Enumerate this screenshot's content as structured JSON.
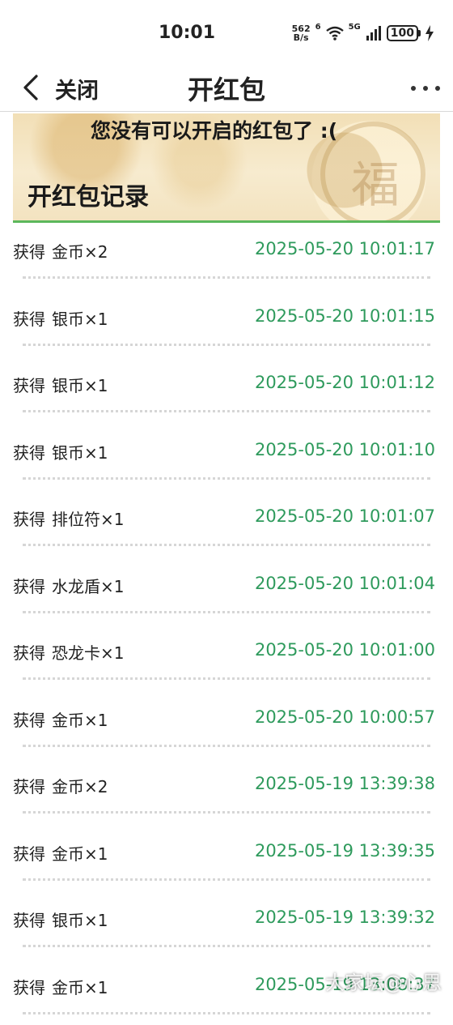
{
  "status_bar": {
    "time": "10:01",
    "net_speed_value": "562",
    "net_speed_unit": "B/s",
    "wifi_badge": "6",
    "signal_badge": "5G",
    "battery": "100",
    "icons": [
      "wifi-icon",
      "cellular-signal-icon",
      "battery-icon",
      "charging-icon"
    ]
  },
  "nav": {
    "back_icon": "chevron-left-icon",
    "close_label": "关闭",
    "title": "开红包",
    "more_icon": "more-dots-icon"
  },
  "banner": {
    "message": "您没有可以开启的红包了 :(",
    "heading": "开红包记录",
    "accent_color": "#5cb85c"
  },
  "records": [
    {
      "verb": "获得",
      "item": "金币×2",
      "time": "2025-05-20 10:01:17"
    },
    {
      "verb": "获得",
      "item": "银币×1",
      "time": "2025-05-20 10:01:15"
    },
    {
      "verb": "获得",
      "item": "银币×1",
      "time": "2025-05-20 10:01:12"
    },
    {
      "verb": "获得",
      "item": "银币×1",
      "time": "2025-05-20 10:01:10"
    },
    {
      "verb": "获得",
      "item": "排位符×1",
      "time": "2025-05-20 10:01:07"
    },
    {
      "verb": "获得",
      "item": "水龙盾×1",
      "time": "2025-05-20 10:01:04"
    },
    {
      "verb": "获得",
      "item": "恐龙卡×1",
      "time": "2025-05-20 10:01:00"
    },
    {
      "verb": "获得",
      "item": "金币×1",
      "time": "2025-05-20 10:00:57"
    },
    {
      "verb": "获得",
      "item": "金币×2",
      "time": "2025-05-19 13:39:38"
    },
    {
      "verb": "获得",
      "item": "金币×1",
      "time": "2025-05-19 13:39:35"
    },
    {
      "verb": "获得",
      "item": "银币×1",
      "time": "2025-05-19 13:39:32"
    },
    {
      "verb": "获得",
      "item": "金币×1",
      "time": "2025-05-19 13:08:37"
    }
  ],
  "time_color": "#2e9a5c",
  "watermark": "大家坛@心思"
}
